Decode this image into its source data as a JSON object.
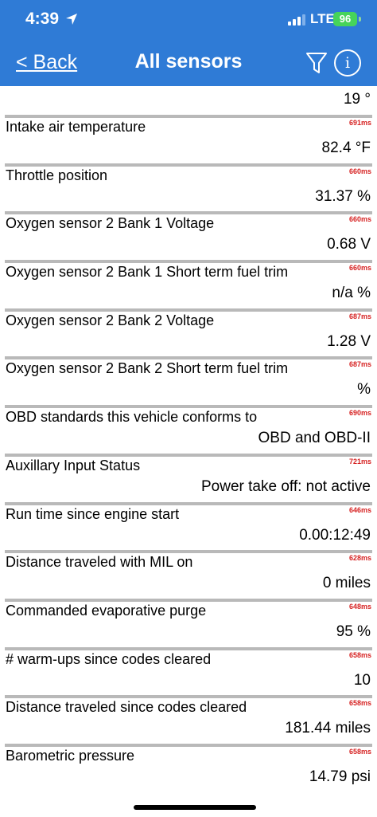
{
  "status_bar": {
    "time": "4:39",
    "network": "LTE",
    "battery": "96"
  },
  "nav": {
    "back_label": "< Back",
    "title": "All sensors",
    "filter_icon": "filter-icon",
    "info_icon": "info-icon",
    "info_glyph": "i"
  },
  "colors": {
    "header_bg": "#2f7bd6",
    "timing_text": "#d62222",
    "divider": "#b9b9b9",
    "battery": "#46d45a"
  },
  "first_value": "19 °",
  "sensors": [
    {
      "label": "Intake air temperature",
      "timing": "691ms",
      "value": "82.4 °F"
    },
    {
      "label": "Throttle position",
      "timing": "660ms",
      "value": "31.37 %"
    },
    {
      "label": "Oxygen sensor 2 Bank 1 Voltage",
      "timing": "660ms",
      "value": "0.68 V"
    },
    {
      "label": "Oxygen sensor 2 Bank 1 Short term fuel trim",
      "timing": "660ms",
      "value": "n/a %"
    },
    {
      "label": "Oxygen sensor 2 Bank 2 Voltage",
      "timing": "687ms",
      "value": "1.28 V"
    },
    {
      "label": "Oxygen sensor 2 Bank 2 Short term fuel trim",
      "timing": "687ms",
      "value": "%"
    },
    {
      "label": "OBD standards this vehicle conforms to",
      "timing": "690ms",
      "value": "OBD and OBD-II"
    },
    {
      "label": "Auxillary Input Status",
      "timing": "721ms",
      "value": "Power take off: not active"
    },
    {
      "label": "Run time since engine start",
      "timing": "646ms",
      "value": "0.00:12:49"
    },
    {
      "label": "Distance traveled with MIL on",
      "timing": "628ms",
      "value": "0 miles"
    },
    {
      "label": "Commanded evaporative purge",
      "timing": "648ms",
      "value": "95 %"
    },
    {
      "label": "# warm-ups since codes cleared",
      "timing": "658ms",
      "value": "10"
    },
    {
      "label": "Distance traveled since codes cleared",
      "timing": "658ms",
      "value": "181.44 miles"
    },
    {
      "label": "Barometric pressure",
      "timing": "658ms",
      "value": "14.79 psi"
    }
  ]
}
